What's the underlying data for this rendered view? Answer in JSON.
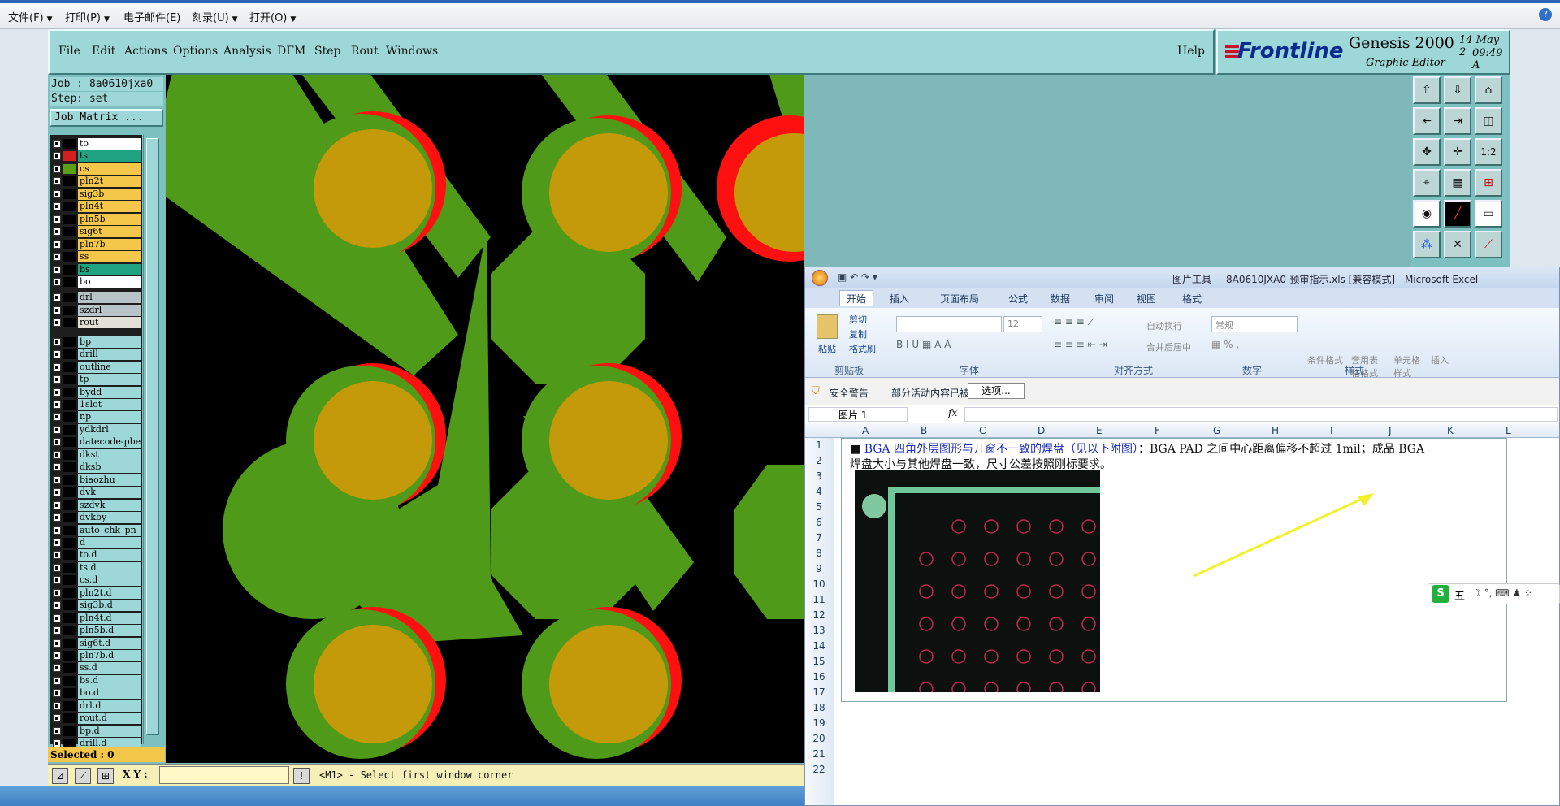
{
  "print_toolbar": {
    "items": [
      "文件(F)",
      "打印(P)",
      "电子邮件(E)",
      "刻录(U)",
      "打开(O)"
    ]
  },
  "genesis": {
    "menu": [
      "File",
      "Edit",
      "Actions",
      "Options",
      "Analysis",
      "DFM",
      "Step",
      "Rout",
      "Windows"
    ],
    "help": "Help",
    "brand": "Frontline",
    "product": "Genesis 2000",
    "subtitle": "Graphic Editor",
    "date": "14 May 2",
    "time": "09:49 A",
    "job": "Job : 8a0610jxa0",
    "step": "Step: set",
    "job_matrix": "Job Matrix ...",
    "selected": "Selected : 0",
    "xy_label": "X Y :",
    "status": "<M1> - Select first window corner",
    "layers": [
      {
        "name": "to",
        "color": "#ffffff",
        "sw": "#000000"
      },
      {
        "name": "ts",
        "color": "#1fa383",
        "sw": "#d42020"
      },
      {
        "name": "cs",
        "color": "#f4c74a",
        "sw": "#5aa012"
      },
      {
        "name": "pln2t",
        "color": "#f4c74a",
        "sw": "#000000"
      },
      {
        "name": "sig3b",
        "color": "#f4c74a",
        "sw": "#000000"
      },
      {
        "name": "pln4t",
        "color": "#f4c74a",
        "sw": "#000000"
      },
      {
        "name": "pln5b",
        "color": "#f4c74a",
        "sw": "#000000"
      },
      {
        "name": "sig6t",
        "color": "#f4c74a",
        "sw": "#000000"
      },
      {
        "name": "pln7b",
        "color": "#f4c74a",
        "sw": "#000000"
      },
      {
        "name": "ss",
        "color": "#f4c74a",
        "sw": "#000000"
      },
      {
        "name": "bs",
        "color": "#1fa383",
        "sw": "#000000"
      },
      {
        "name": "bo",
        "color": "#ffffff",
        "sw": "#000000"
      },
      {
        "name": "drl",
        "color": "#b9c4c8",
        "sw": "#000000"
      },
      {
        "name": "szdrl",
        "color": "#b9c4c8",
        "sw": "#000000"
      },
      {
        "name": "rout",
        "color": "#e3e0d8",
        "sw": "#000000"
      },
      {
        "name": "bp",
        "color": "#9ed7d7",
        "sw": "#000000"
      },
      {
        "name": "drill",
        "color": "#9ed7d7",
        "sw": "#000000"
      },
      {
        "name": "outline",
        "color": "#9ed7d7",
        "sw": "#000000"
      },
      {
        "name": "tp",
        "color": "#9ed7d7",
        "sw": "#000000"
      },
      {
        "name": "bydd",
        "color": "#9ed7d7",
        "sw": "#000000"
      },
      {
        "name": "1slot",
        "color": "#9ed7d7",
        "sw": "#000000"
      },
      {
        "name": "np",
        "color": "#9ed7d7",
        "sw": "#000000"
      },
      {
        "name": "ydkdrl",
        "color": "#9ed7d7",
        "sw": "#000000"
      },
      {
        "name": "datecode-pbe",
        "color": "#9ed7d7",
        "sw": "#000000"
      },
      {
        "name": "dkst",
        "color": "#9ed7d7",
        "sw": "#000000"
      },
      {
        "name": "dksb",
        "color": "#9ed7d7",
        "sw": "#000000"
      },
      {
        "name": "biaozhu",
        "color": "#9ed7d7",
        "sw": "#000000"
      },
      {
        "name": "dvk",
        "color": "#9ed7d7",
        "sw": "#000000"
      },
      {
        "name": "szdvk",
        "color": "#9ed7d7",
        "sw": "#000000"
      },
      {
        "name": "dvkby",
        "color": "#9ed7d7",
        "sw": "#000000"
      },
      {
        "name": "auto_chk_pn",
        "color": "#9ed7d7",
        "sw": "#000000"
      },
      {
        "name": "d",
        "color": "#9ed7d7",
        "sw": "#000000"
      },
      {
        "name": "to.d",
        "color": "#9ed7d7",
        "sw": "#000000"
      },
      {
        "name": "ts.d",
        "color": "#9ed7d7",
        "sw": "#000000"
      },
      {
        "name": "cs.d",
        "color": "#9ed7d7",
        "sw": "#000000"
      },
      {
        "name": "pln2t.d",
        "color": "#9ed7d7",
        "sw": "#000000"
      },
      {
        "name": "sig3b.d",
        "color": "#9ed7d7",
        "sw": "#000000"
      },
      {
        "name": "pln4t.d",
        "color": "#9ed7d7",
        "sw": "#000000"
      },
      {
        "name": "pln5b.d",
        "color": "#9ed7d7",
        "sw": "#000000"
      },
      {
        "name": "sig6t.d",
        "color": "#9ed7d7",
        "sw": "#000000"
      },
      {
        "name": "pln7b.d",
        "color": "#9ed7d7",
        "sw": "#000000"
      },
      {
        "name": "ss.d",
        "color": "#9ed7d7",
        "sw": "#000000"
      },
      {
        "name": "bs.d",
        "color": "#9ed7d7",
        "sw": "#000000"
      },
      {
        "name": "bo.d",
        "color": "#9ed7d7",
        "sw": "#000000"
      },
      {
        "name": "drl.d",
        "color": "#9ed7d7",
        "sw": "#000000"
      },
      {
        "name": "rout.d",
        "color": "#9ed7d7",
        "sw": "#000000"
      },
      {
        "name": "bp.d",
        "color": "#9ed7d7",
        "sw": "#000000"
      },
      {
        "name": "drill.d",
        "color": "#9ed7d7",
        "sw": "#000000"
      }
    ],
    "colors": {
      "trace": "#4f9a19",
      "pad": "#c49a0a",
      "mask": "#ff1010",
      "bg": "#000000"
    },
    "tool_labels": [
      "1:2"
    ]
  },
  "excel": {
    "title_tool": "图片工具",
    "title": "8A0610JXA0-预审指示.xls [兼容模式] - Microsoft Excel",
    "tabs": [
      "开始",
      "插入",
      "页面布局",
      "公式",
      "数据",
      "审阅",
      "视图",
      "格式"
    ],
    "clipboard": {
      "paste": "粘贴",
      "cut": "剪切",
      "copy": "复制",
      "format_painter": "格式刷",
      "group": "剪贴板"
    },
    "font": {
      "size": "12",
      "group": "字体"
    },
    "align": {
      "wrap": "自动换行",
      "merge": "合并后居中",
      "group": "对齐方式"
    },
    "number": {
      "format": "常规",
      "group": "数字"
    },
    "styles": {
      "cond": "条件格式",
      "table": "套用表格格式",
      "cell": "单元格样式",
      "group": "样式"
    },
    "insert": "插入",
    "security": {
      "label": "安全警告",
      "msg": "部分活动内容已被禁用。",
      "button": "选项..."
    },
    "name_box": "图片 1",
    "fx": "fx",
    "columns": [
      "A",
      "B",
      "C",
      "D",
      "E",
      "F",
      "G",
      "H",
      "I",
      "J",
      "K",
      "L"
    ],
    "rows": [
      "1",
      "2",
      "3",
      "4",
      "5",
      "6",
      "7",
      "8",
      "9",
      "10",
      "11",
      "12",
      "13",
      "14",
      "15",
      "16",
      "17",
      "18",
      "19",
      "20",
      "21",
      "22"
    ],
    "note_bullet": "■",
    "note_blue": "BGA 四角外层图形与开窗不一致的焊盘（见以下附图）",
    "note_rest": "：BGA PAD 之间中心距离偏移不超过 1mil；成品 BGA",
    "note_line2": "焊盘大小与其他焊盘一致，尺寸公差按照刚标要求。",
    "ime": "五"
  }
}
